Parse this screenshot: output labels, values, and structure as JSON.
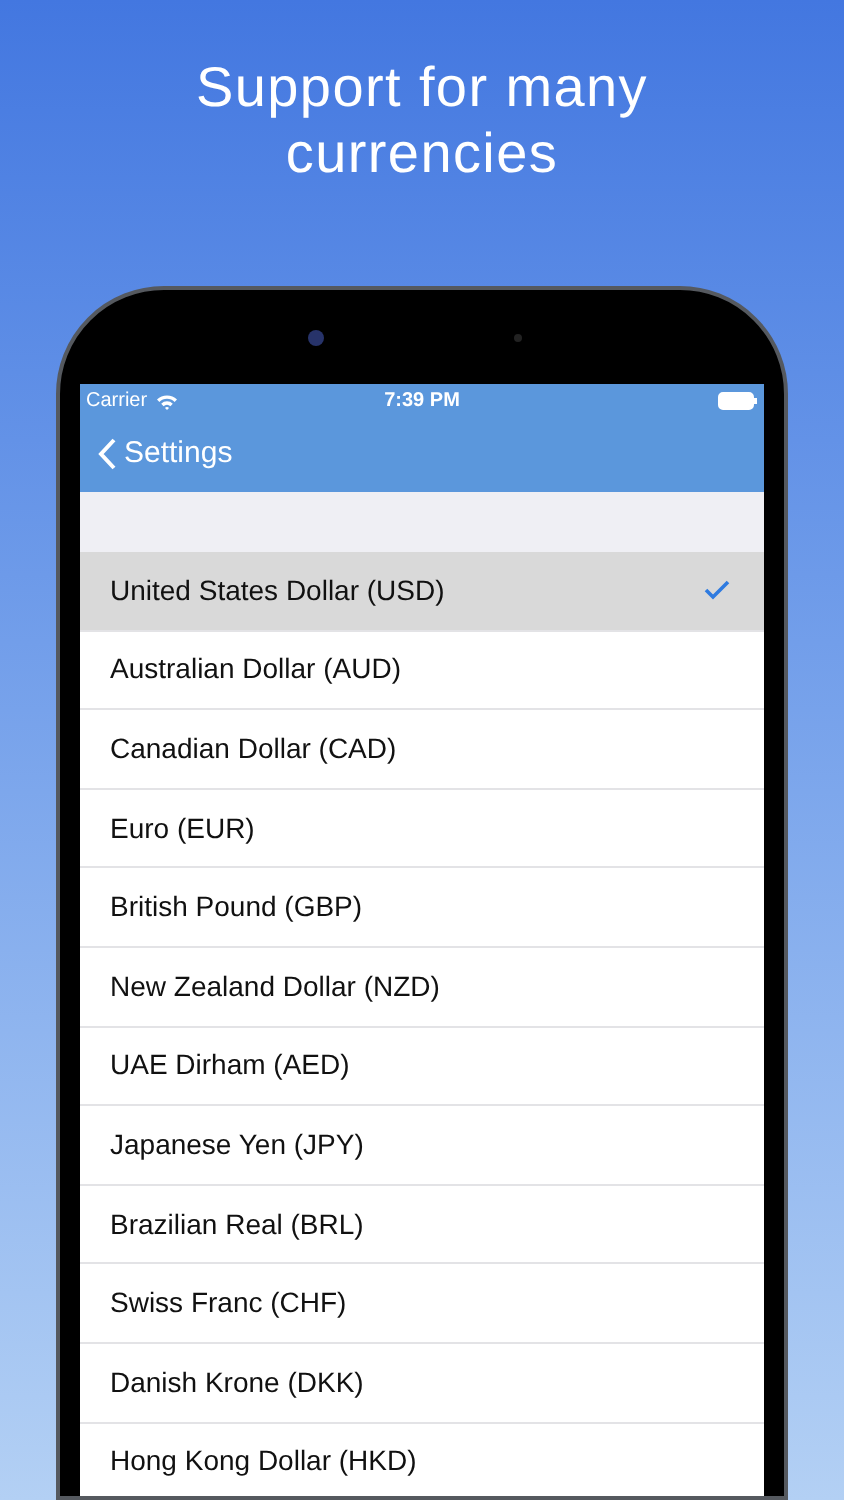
{
  "headline": "Support for many currencies",
  "status_bar": {
    "carrier": "Carrier",
    "time": "7:39 PM"
  },
  "nav": {
    "back": "Settings"
  },
  "currencies": [
    {
      "label": "United States Dollar (USD)",
      "selected": true
    },
    {
      "label": "Australian Dollar (AUD)",
      "selected": false
    },
    {
      "label": "Canadian Dollar (CAD)",
      "selected": false
    },
    {
      "label": "Euro (EUR)",
      "selected": false
    },
    {
      "label": "British Pound (GBP)",
      "selected": false
    },
    {
      "label": "New Zealand Dollar (NZD)",
      "selected": false
    },
    {
      "label": "UAE Dirham (AED)",
      "selected": false
    },
    {
      "label": "Japanese Yen (JPY)",
      "selected": false
    },
    {
      "label": "Brazilian Real (BRL)",
      "selected": false
    },
    {
      "label": "Swiss Franc (CHF)",
      "selected": false
    },
    {
      "label": "Danish Krone (DKK)",
      "selected": false
    },
    {
      "label": "Hong Kong Dollar (HKD)",
      "selected": false
    }
  ]
}
